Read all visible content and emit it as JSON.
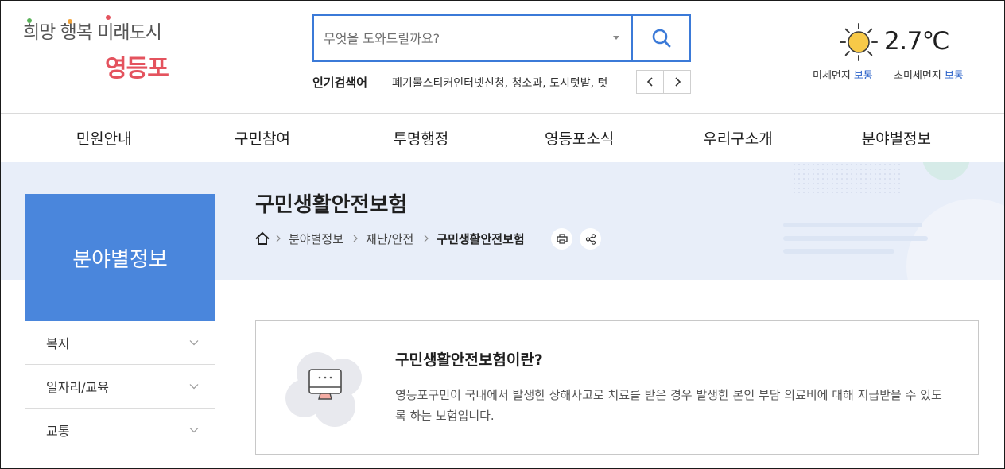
{
  "logo": {
    "slogan": "희망 행복 미래도시",
    "name": "영등포"
  },
  "search": {
    "placeholder": "무엇을 도와드릴까요?",
    "popular_label": "인기검색어",
    "popular_terms": "폐기물스티커인터넷신청, 청소과, 도시텃밭, 텃"
  },
  "weather": {
    "icon": "sun-icon",
    "temperature": "2.7℃",
    "fine_dust": {
      "label": "미세먼지",
      "value": "보통"
    },
    "ultrafine_dust": {
      "label": "초미세먼지",
      "value": "보통"
    }
  },
  "nav": {
    "items": [
      {
        "label": "민원안내"
      },
      {
        "label": "구민참여"
      },
      {
        "label": "투명행정"
      },
      {
        "label": "영등포소식"
      },
      {
        "label": "우리구소개"
      },
      {
        "label": "분야별정보"
      }
    ]
  },
  "sidebar": {
    "title": "분야별정보",
    "items": [
      {
        "label": "복지"
      },
      {
        "label": "일자리/교육"
      },
      {
        "label": "교통"
      }
    ]
  },
  "page": {
    "title": "구민생활안전보험",
    "breadcrumb": [
      "분야별정보",
      "재난/안전",
      "구민생활안전보험"
    ]
  },
  "content": {
    "heading": "구민생활안전보험이란?",
    "description": "영등포구민이 국내에서 발생한 상해사고로 치료를 받은 경우 발생한 본인 부담 의료비에 대해 지급받을 수 있도록 하는 보험입니다."
  },
  "colors": {
    "accent": "#3b7ad8",
    "brand": "#e4535e",
    "sidebar_title_bg": "#4a86dc",
    "status_good": "#2a62c9",
    "banner_bg": "#e8eef9"
  },
  "icons": [
    "search-icon",
    "chevron-down-icon",
    "chevron-left-icon",
    "chevron-right-icon",
    "sun-icon",
    "home-icon",
    "breadcrumb-separator-icon",
    "print-icon",
    "share-icon",
    "monitor-illustration-icon"
  ]
}
